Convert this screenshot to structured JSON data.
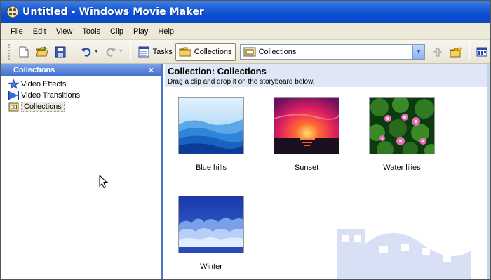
{
  "window": {
    "title": "Untitled - Windows Movie Maker"
  },
  "menu": {
    "items": [
      "File",
      "Edit",
      "View",
      "Tools",
      "Clip",
      "Play",
      "Help"
    ]
  },
  "toolbar": {
    "tasks_label": "Tasks",
    "collections_label": "Collections",
    "combo_value": "Collections"
  },
  "left_pane": {
    "title": "Collections",
    "close_glyph": "×",
    "items": [
      {
        "label": "Video Effects",
        "icon": "star-icon"
      },
      {
        "label": "Video Transitions",
        "icon": "transition-icon"
      },
      {
        "label": "Collections",
        "icon": "collection-folder-icon",
        "selected": true
      }
    ]
  },
  "content": {
    "title": "Collection: Collections",
    "subtitle": "Drag a clip and drop it on the storyboard below.",
    "clips": [
      {
        "label": "Blue hills"
      },
      {
        "label": "Sunset"
      },
      {
        "label": "Water lilies"
      },
      {
        "label": "Winter"
      }
    ]
  },
  "colors": {
    "titlebar": "#0a4ad0",
    "pane_header": "#3f6dcc",
    "content_header": "#dfe6f5"
  }
}
